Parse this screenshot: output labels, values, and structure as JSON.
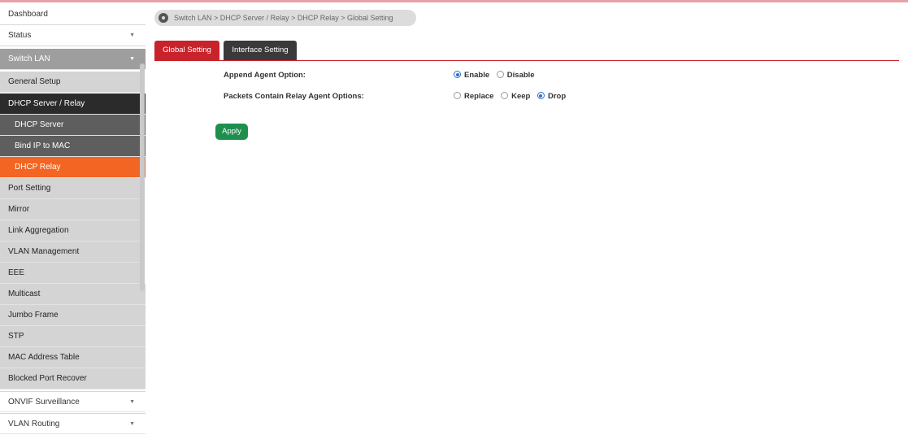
{
  "sidebar": {
    "items": [
      {
        "label": "Dashboard"
      },
      {
        "label": "Status"
      },
      {
        "label": "Switch LAN"
      },
      {
        "label": "General Setup"
      },
      {
        "label": "DHCP Server / Relay"
      },
      {
        "label": "DHCP Server"
      },
      {
        "label": "Bind IP to MAC"
      },
      {
        "label": "DHCP Relay"
      },
      {
        "label": "Port Setting"
      },
      {
        "label": "Mirror"
      },
      {
        "label": "Link Aggregation"
      },
      {
        "label": "VLAN Management"
      },
      {
        "label": "EEE"
      },
      {
        "label": "Multicast"
      },
      {
        "label": "Jumbo Frame"
      },
      {
        "label": "STP"
      },
      {
        "label": "MAC Address Table"
      },
      {
        "label": "Blocked Port Recover"
      },
      {
        "label": "ONVIF Surveillance"
      },
      {
        "label": "VLAN Routing"
      }
    ]
  },
  "breadcrumb": {
    "text": "Switch LAN > DHCP Server / Relay > DHCP Relay  > Global Setting"
  },
  "tabs": [
    {
      "label": "Global Setting",
      "active": true
    },
    {
      "label": "Interface Setting",
      "active": false
    }
  ],
  "form": {
    "append_agent": {
      "label": "Append Agent Option:",
      "options": [
        "Enable",
        "Disable"
      ],
      "selected": "Enable"
    },
    "packets_relay": {
      "label": "Packets Contain Relay Agent Options:",
      "options": [
        "Replace",
        "Keep",
        "Drop"
      ],
      "selected": "Drop"
    },
    "apply_label": "Apply"
  },
  "colors": {
    "accent_red": "#c8222b",
    "active_orange": "#f26522",
    "apply_green": "#1f8f4e",
    "radio_blue": "#2a73c8"
  }
}
